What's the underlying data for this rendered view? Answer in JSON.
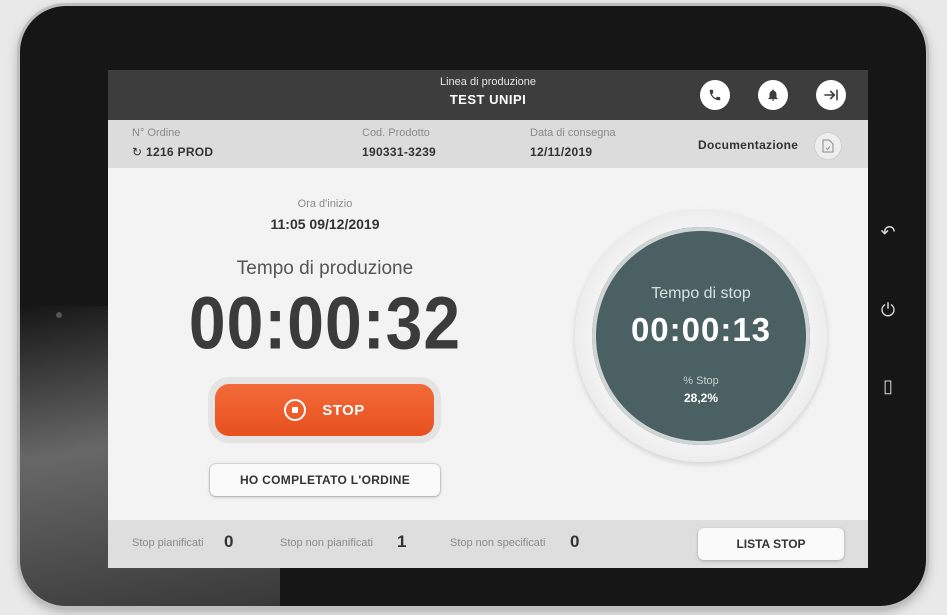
{
  "header": {
    "subtitle": "Linea di produzione",
    "title": "TEST UNIPI",
    "icons": [
      "phone-icon",
      "bell-icon",
      "logout-icon"
    ]
  },
  "info": {
    "order_label": "N° Ordine",
    "order_value": "1216 PROD",
    "product_label": "Cod. Prodotto",
    "product_value": "190331-3239",
    "delivery_label": "Data di consegna",
    "delivery_value": "12/11/2019",
    "doc_label": "Documentazione"
  },
  "main": {
    "start_label": "Ora d'inizio",
    "start_value": "11:05 09/12/2019",
    "prod_time_label": "Tempo di produzione",
    "prod_time_value": "00:00:32",
    "stop_button": "STOP",
    "complete_button": "HO COMPLETATO L'ORDINE"
  },
  "dial": {
    "label": "Tempo di stop",
    "time": "00:00:13",
    "pct_label": "% Stop",
    "pct_value": "28,2%"
  },
  "footer": {
    "planned_label": "Stop pianificati",
    "planned_value": "0",
    "unplanned_label": "Stop non pianificati",
    "unplanned_value": "1",
    "unspecified_label": "Stop non specificati",
    "unspecified_value": "0",
    "list_button": "LISTA STOP"
  },
  "colors": {
    "accent": "#e8501d",
    "topbar": "#3d3d3d",
    "dial": "#4a6063"
  }
}
